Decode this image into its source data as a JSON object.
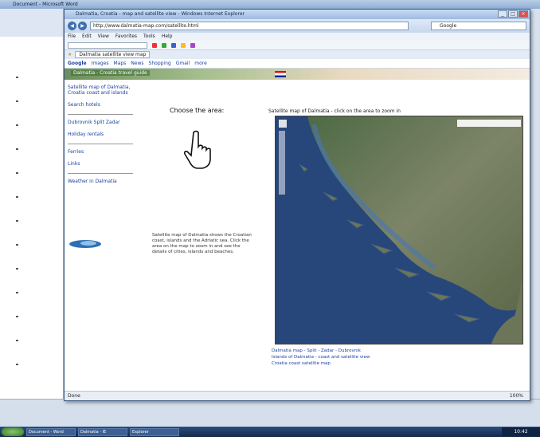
{
  "bg_window": {
    "title": "Document - Microsoft Word"
  },
  "browser": {
    "title": "Dalmatia, Croatia - map and satellite view - Windows Internet Explorer",
    "url": "http://www.dalmatia-map.com/satellite.html",
    "search_placeholder": "Google",
    "menu": [
      "File",
      "Edit",
      "View",
      "Favorites",
      "Tools",
      "Help"
    ],
    "tab_label": "Dalmatia satellite view map",
    "google_bar": [
      "Google",
      "Images",
      "Maps",
      "News",
      "Shopping",
      "Gmail",
      "more"
    ],
    "banner_text": "Dalmatia - Croatia travel guide",
    "status": "Done",
    "zoom": "100%"
  },
  "page": {
    "left_col": [
      "Satellite map of Dalmatia, Croatia coast and islands",
      "Search hotels",
      "Dubrovnik Split Zadar",
      "Holiday rentals",
      "Ferries",
      "Links",
      "Weather in Dalmatia"
    ],
    "heading": "Choose the area:",
    "mid_text": "Satellite map of Dalmatia shows the Croatian coast, islands and the Adriatic sea. Click the area on the map to zoom in and see the details of cities, islands and beaches.",
    "map_title": "Satellite map of Dalmatia - click on the area to zoom in",
    "map_caption": [
      "Dalmatia map - Split - Zadar - Dubrovnik",
      "Islands of Dalmatia - coast and satellite view",
      "Croatia coast satellite map"
    ]
  },
  "taskbar": {
    "items": [
      "Document - Word",
      "Dalmatia - IE",
      "Explorer"
    ],
    "clock": "10:42"
  }
}
